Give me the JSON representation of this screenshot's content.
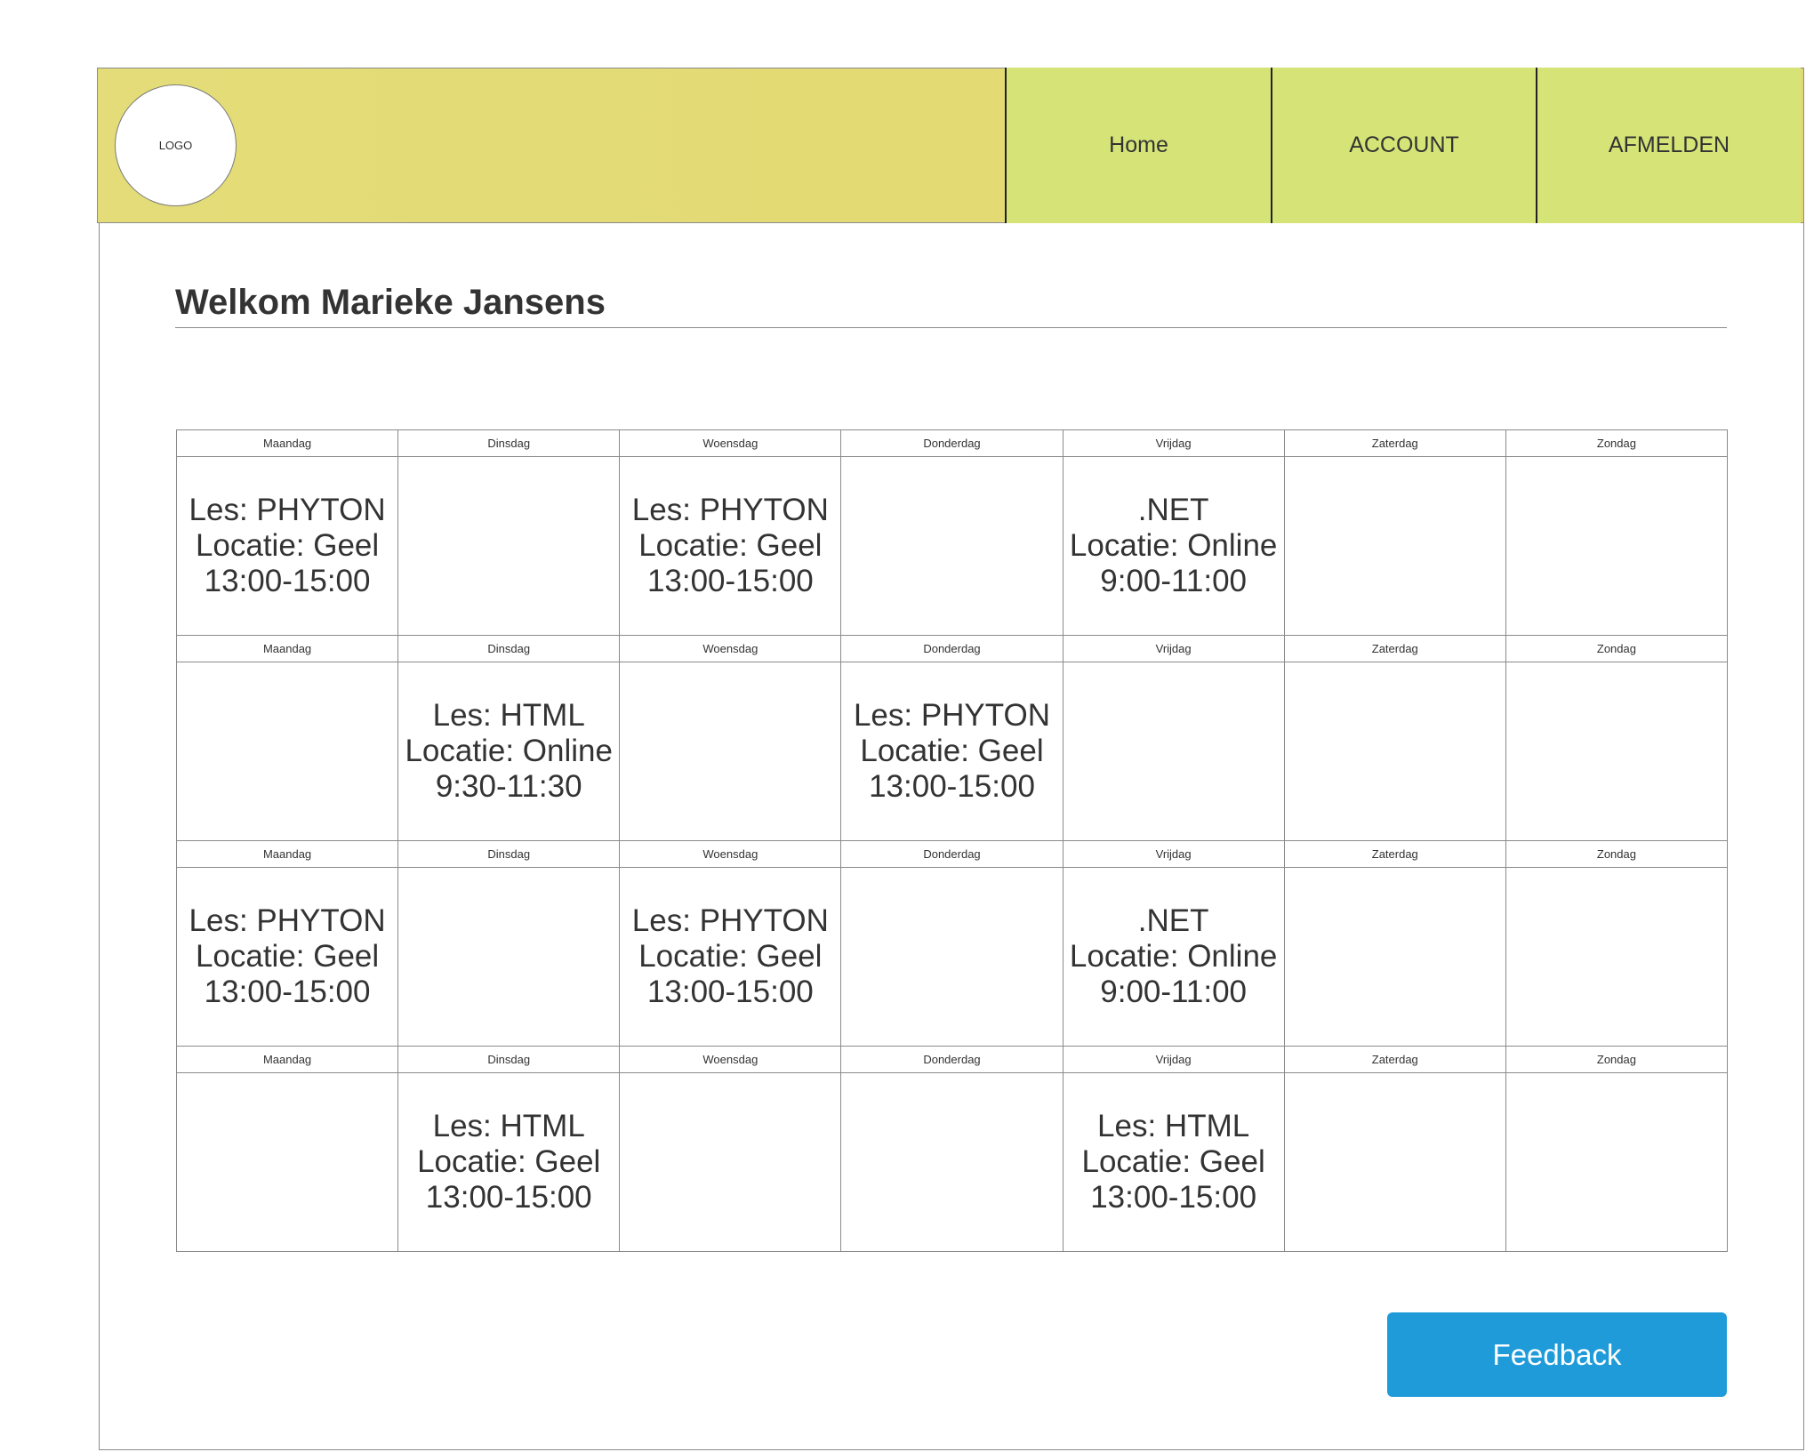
{
  "header": {
    "logo_text": "LOGO",
    "nav": [
      {
        "label": "Home"
      },
      {
        "label": "ACCOUNT"
      },
      {
        "label": "AFMELDEN"
      }
    ]
  },
  "main": {
    "welcome_title": "Welkom Marieke Jansens",
    "feedback_label": "Feedback"
  },
  "schedule": {
    "days": [
      "Maandag",
      "Dinsdag",
      "Woensdag",
      "Donderdag",
      "Vrijdag",
      "Zaterdag",
      "Zondag"
    ],
    "weeks": [
      [
        [
          "Les: PHYTON",
          "Locatie: Geel",
          "13:00-15:00"
        ],
        [],
        [
          "Les: PHYTON",
          "Locatie: Geel",
          "13:00-15:00"
        ],
        [],
        [
          ".NET",
          "Locatie: Online",
          "9:00-11:00"
        ],
        [],
        []
      ],
      [
        [],
        [
          "Les: HTML",
          "Locatie: Online",
          "9:30-11:30"
        ],
        [],
        [
          "Les: PHYTON",
          "Locatie: Geel",
          "13:00-15:00"
        ],
        [],
        [],
        []
      ],
      [
        [
          "Les: PHYTON",
          "Locatie: Geel",
          "13:00-15:00"
        ],
        [],
        [
          "Les: PHYTON",
          "Locatie: Geel",
          "13:00-15:00"
        ],
        [],
        [
          ".NET",
          "Locatie: Online",
          "9:00-11:00"
        ],
        [],
        []
      ],
      [
        [],
        [
          "Les: HTML",
          "Locatie: Geel",
          "13:00-15:00"
        ],
        [],
        [],
        [
          "Les: HTML",
          "Locatie: Geel",
          "13:00-15:00"
        ],
        [],
        []
      ]
    ]
  },
  "colors": {
    "header_bg": "#e3da74",
    "nav_bg": "#d6e477",
    "feedback_bg": "#1f9bd9",
    "text": "#333333"
  }
}
